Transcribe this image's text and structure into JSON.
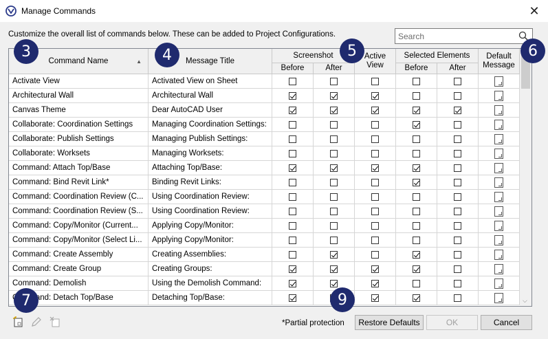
{
  "window": {
    "title": "Manage Commands"
  },
  "intro_text": "Customize the overall list of commands below. These can be added to Project Configurations.",
  "search": {
    "placeholder": "Search",
    "value": ""
  },
  "columns": {
    "command_name": "Command Name",
    "message_title": "Message Title",
    "screenshot": "Screenshot",
    "active_view": "Active View",
    "selected_elements": "Selected Elements",
    "default_message": "Default Message",
    "before": "Before",
    "after": "After"
  },
  "rows": [
    {
      "command": "Activate View",
      "title": "Activated View on Sheet",
      "checks": [
        false,
        false,
        false,
        false,
        false
      ]
    },
    {
      "command": "Architectural Wall",
      "title": "Architectural Wall",
      "checks": [
        true,
        true,
        true,
        false,
        false
      ]
    },
    {
      "command": "Canvas Theme",
      "title": "Dear AutoCAD User",
      "checks": [
        true,
        true,
        true,
        true,
        true
      ]
    },
    {
      "command": "Collaborate: Coordination Settings",
      "title": "Managing Coordination Settings:",
      "checks": [
        false,
        false,
        false,
        true,
        false
      ]
    },
    {
      "command": "Collaborate: Publish Settings",
      "title": "Managing Publish Settings:",
      "checks": [
        false,
        false,
        false,
        false,
        false
      ]
    },
    {
      "command": "Collaborate: Worksets",
      "title": "Managing Worksets:",
      "checks": [
        false,
        false,
        false,
        false,
        false
      ]
    },
    {
      "command": "Command: Attach Top/Base",
      "title": "Attaching Top/Base:",
      "checks": [
        true,
        true,
        true,
        true,
        false
      ]
    },
    {
      "command": "Command: Bind Revit Link*",
      "title": "Binding Revit Links:",
      "checks": [
        false,
        false,
        false,
        true,
        false
      ]
    },
    {
      "command": "Command: Coordination Review (C...",
      "title": "Using Coordination Review:",
      "checks": [
        false,
        false,
        false,
        false,
        false
      ]
    },
    {
      "command": "Command: Coordination Review (S...",
      "title": "Using Coordination Review:",
      "checks": [
        false,
        false,
        false,
        false,
        false
      ]
    },
    {
      "command": "Command: Copy/Monitor (Current...",
      "title": "Applying Copy/Monitor:",
      "checks": [
        false,
        false,
        false,
        false,
        false
      ]
    },
    {
      "command": "Command: Copy/Monitor (Select Li...",
      "title": "Applying Copy/Monitor:",
      "checks": [
        false,
        false,
        false,
        false,
        false
      ]
    },
    {
      "command": "Command: Create Assembly",
      "title": "Creating Assemblies:",
      "checks": [
        false,
        true,
        false,
        true,
        false
      ]
    },
    {
      "command": "Command: Create Group",
      "title": "Creating Groups:",
      "checks": [
        true,
        true,
        true,
        true,
        false
      ]
    },
    {
      "command": "Command: Demolish",
      "title": "Using the Demolish Command:",
      "checks": [
        true,
        true,
        true,
        false,
        false
      ]
    },
    {
      "command": "Command: Detach Top/Base",
      "title": "Detaching Top/Base:",
      "checks": [
        true,
        false,
        true,
        true,
        false
      ]
    }
  ],
  "badges": [
    "3",
    "4",
    "5",
    "6",
    "7",
    "9"
  ],
  "footer": {
    "partial_note": "*Partial protection",
    "restore_label": "Restore Defaults",
    "ok_label": "OK",
    "cancel_label": "Cancel"
  },
  "icons": {
    "app": "revit-logo-icon",
    "close": "close-icon",
    "search": "search-icon",
    "sort": "sort-ascending-icon",
    "new": "new-command-icon",
    "edit": "edit-pencil-icon",
    "delete": "delete-command-icon"
  },
  "colors": {
    "badge": "#1f2a6e",
    "header_bg": "#f0f0f0",
    "accent": "#1f2a6e"
  }
}
